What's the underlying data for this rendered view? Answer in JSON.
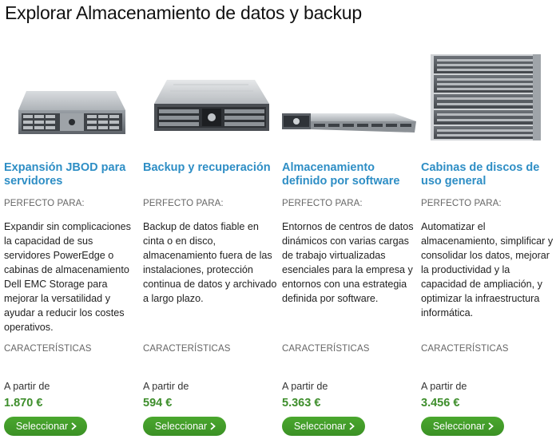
{
  "page": {
    "title": "Explorar Almacenamiento de datos y backup"
  },
  "colors": {
    "title_link": "#2e8ec5",
    "price": "#3e8e2c",
    "button": "#43a02a"
  },
  "products": [
    {
      "image_icon": "storage-enclosure-2u-image",
      "title": "Expansión JBOD para servidores",
      "perfect_label": "PERFECTO PARA:",
      "description": "Expandir sin complicaciones la capacidad de sus servidores PowerEdge o cabinas de almacenamiento Dell EMC Storage para mejorar la versatilidad y ayudar a reducir los costes operativos.",
      "features_label": "CARACTERÍSTICAS",
      "price_from": "A partir de",
      "price": "1.870 €",
      "button_label": "Seleccionar"
    },
    {
      "image_icon": "backup-appliance-2u-image",
      "title": "Backup y recuperación",
      "perfect_label": "PERFECTO PARA:",
      "description": "Backup de datos fiable en cinta o en disco, almacenamiento fuera de las instalaciones, protección continua de datos y archivado a largo plazo.",
      "features_label": "CARACTERÍSTICAS",
      "price_from": "A partir de",
      "price": "594 €",
      "button_label": "Seleccionar"
    },
    {
      "image_icon": "rack-server-1u-image",
      "title": "Almacenamiento definido por software",
      "perfect_label": "PERFECTO PARA:",
      "description": "Entornos de centros de datos dinámicos con varias cargas de trabajo virtualizadas esenciales para la empresa y entornos con una estrategia definida por software.",
      "features_label": "CARACTERÍSTICAS",
      "price_from": "A partir de",
      "price": "5.363 €",
      "button_label": "Seleccionar"
    },
    {
      "image_icon": "disk-array-stack-image",
      "title": "Cabinas de discos de uso general",
      "perfect_label": "PERFECTO PARA:",
      "description": "Automatizar el almacenamiento, simplificar y consolidar los datos, mejorar la productividad y la capacidad de ampliación, y optimizar la infraestructura informática.",
      "features_label": "CARACTERÍSTICAS",
      "price_from": "A partir de",
      "price": "3.456 €",
      "button_label": "Seleccionar"
    }
  ]
}
